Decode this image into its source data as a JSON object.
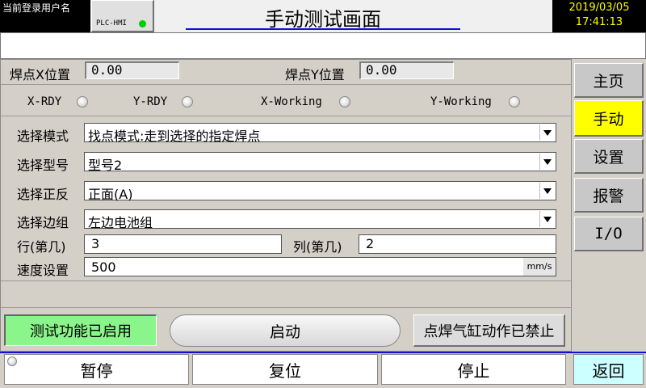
{
  "header": {
    "user_label": "当前登录用户名",
    "plc_label": "PLC-HMI",
    "title": "手动测试画面",
    "date": "2019/03/05",
    "time": "17:41:13",
    "status_led_color": "#00cc00"
  },
  "position": {
    "x_label": "焊点X位置",
    "x_value": "0.00",
    "y_label": "焊点Y位置",
    "y_value": "0.00"
  },
  "indicators": [
    {
      "label": "X-RDY"
    },
    {
      "label": "Y-RDY"
    },
    {
      "label": "X-Working"
    },
    {
      "label": "Y-Working"
    }
  ],
  "form": {
    "mode_label": "选择模式",
    "mode_value": "找点模式:走到选择的指定焊点",
    "model_label": "选择型号",
    "model_value": "型号2",
    "side_label": "选择正反",
    "side_value": "正面(A)",
    "group_label": "选择边组",
    "group_value": "左边电池组",
    "row_label": "行(第几)",
    "row_value": "3",
    "col_label": "列(第几)",
    "col_value": "2",
    "speed_label": "速度设置",
    "speed_value": "500",
    "speed_unit": "mm/s"
  },
  "actions": {
    "test_status": "测试功能已启用",
    "start": "启动",
    "cylinder_status": "点焊气缸动作已禁止",
    "test_status_color": "#8af58a"
  },
  "nav": {
    "home": "主页",
    "manual": "手动",
    "settings": "设置",
    "alarm": "报警",
    "io": "I/O",
    "active_color": "#ffff00"
  },
  "bottom": {
    "pause": "暂停",
    "reset": "复位",
    "stop": "停止",
    "back": "返回",
    "back_color": "#ccffff"
  }
}
